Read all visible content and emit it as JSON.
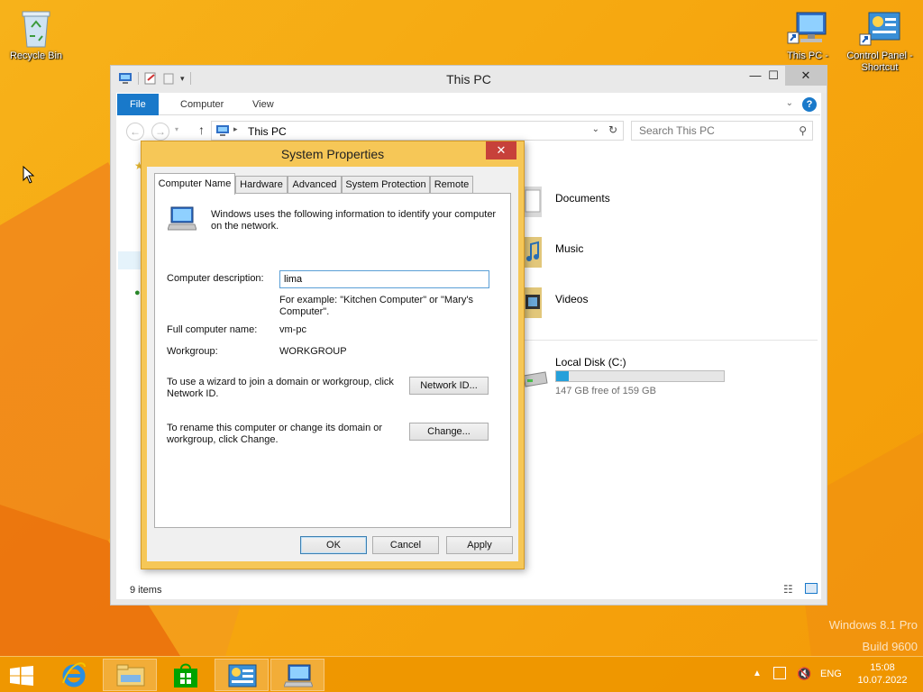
{
  "desktop": {
    "icons": [
      {
        "label": "Recycle Bin"
      },
      {
        "label": "This PC -"
      },
      {
        "label": "Control Panel - Shortcut"
      }
    ],
    "watermark_line1": "Windows 8.1 Pro",
    "watermark_line2": "Build 9600"
  },
  "explorer": {
    "title": "This PC",
    "ribbon_tabs": [
      "File",
      "Computer",
      "View"
    ],
    "address": "This PC",
    "search_placeholder": "Search This PC",
    "folders": [
      "Documents",
      "Music",
      "Videos"
    ],
    "drive": {
      "label": "Local Disk (C:)",
      "free_text": "147 GB free of 159 GB",
      "used_fraction": 0.075
    },
    "status": "9 items"
  },
  "dialog": {
    "title": "System Properties",
    "close_glyph": "✕",
    "tabs": [
      "Computer Name",
      "Hardware",
      "Advanced",
      "System Protection",
      "Remote"
    ],
    "intro": "Windows uses the following information to identify your computer on the network.",
    "description_label": "Computer description:",
    "description_value": "lima",
    "example_text": "For example: \"Kitchen Computer\" or \"Mary's Computer\".",
    "full_name_label": "Full computer name:",
    "full_name_value": "vm-pc",
    "workgroup_label": "Workgroup:",
    "workgroup_value": "WORKGROUP",
    "network_id_text": "To use a wizard to join a domain or workgroup, click Network ID.",
    "network_id_button": "Network ID...",
    "change_text": "To rename this computer or change its domain or workgroup, click Change.",
    "change_button": "Change...",
    "ok": "OK",
    "cancel": "Cancel",
    "apply": "Apply"
  },
  "taskbar": {
    "language": "ENG",
    "time": "15:08",
    "date": "10.07.2022"
  },
  "colors": {
    "accent": "#1979ca",
    "dialog_frame": "#f6c757",
    "taskbar": "#ee9600",
    "close_red": "#c7413a"
  }
}
